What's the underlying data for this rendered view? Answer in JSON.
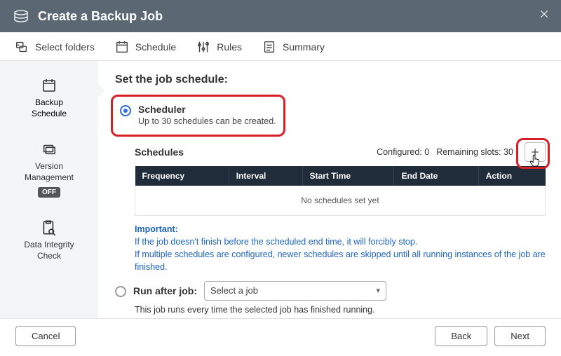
{
  "header": {
    "title": "Create a Backup Job"
  },
  "steps": {
    "select_folders": "Select folders",
    "schedule": "Schedule",
    "rules": "Rules",
    "summary": "Summary"
  },
  "sidebar": {
    "backup_schedule_l1": "Backup",
    "backup_schedule_l2": "Schedule",
    "version_mgmt_l1": "Version",
    "version_mgmt_l2": "Management",
    "version_off_badge": "OFF",
    "integrity_l1": "Data Integrity",
    "integrity_l2": "Check"
  },
  "schedule": {
    "heading": "Set the job schedule:",
    "scheduler_label": "Scheduler",
    "scheduler_desc": "Up to 30 schedules can be created.",
    "schedules_title": "Schedules",
    "configured_label": "Configured:",
    "configured_value": "0",
    "remaining_label": "Remaining slots:",
    "remaining_value": "30",
    "columns": {
      "frequency": "Frequency",
      "interval": "Interval",
      "start_time": "Start Time",
      "end_date": "End Date",
      "action": "Action"
    },
    "empty_text": "No schedules set yet",
    "important_title": "Important:",
    "important_line1": "If the job doesn't finish before the scheduled end time, it will forcibly stop.",
    "important_line2": "If multiple schedules are configured, newer schedules are skipped until all running instances of the job are finished.",
    "run_after_label": "Run after job:",
    "run_after_placeholder": "Select a job",
    "run_after_desc": "This job runs every time the selected job has finished running."
  },
  "footer": {
    "cancel": "Cancel",
    "back": "Back",
    "next": "Next"
  }
}
